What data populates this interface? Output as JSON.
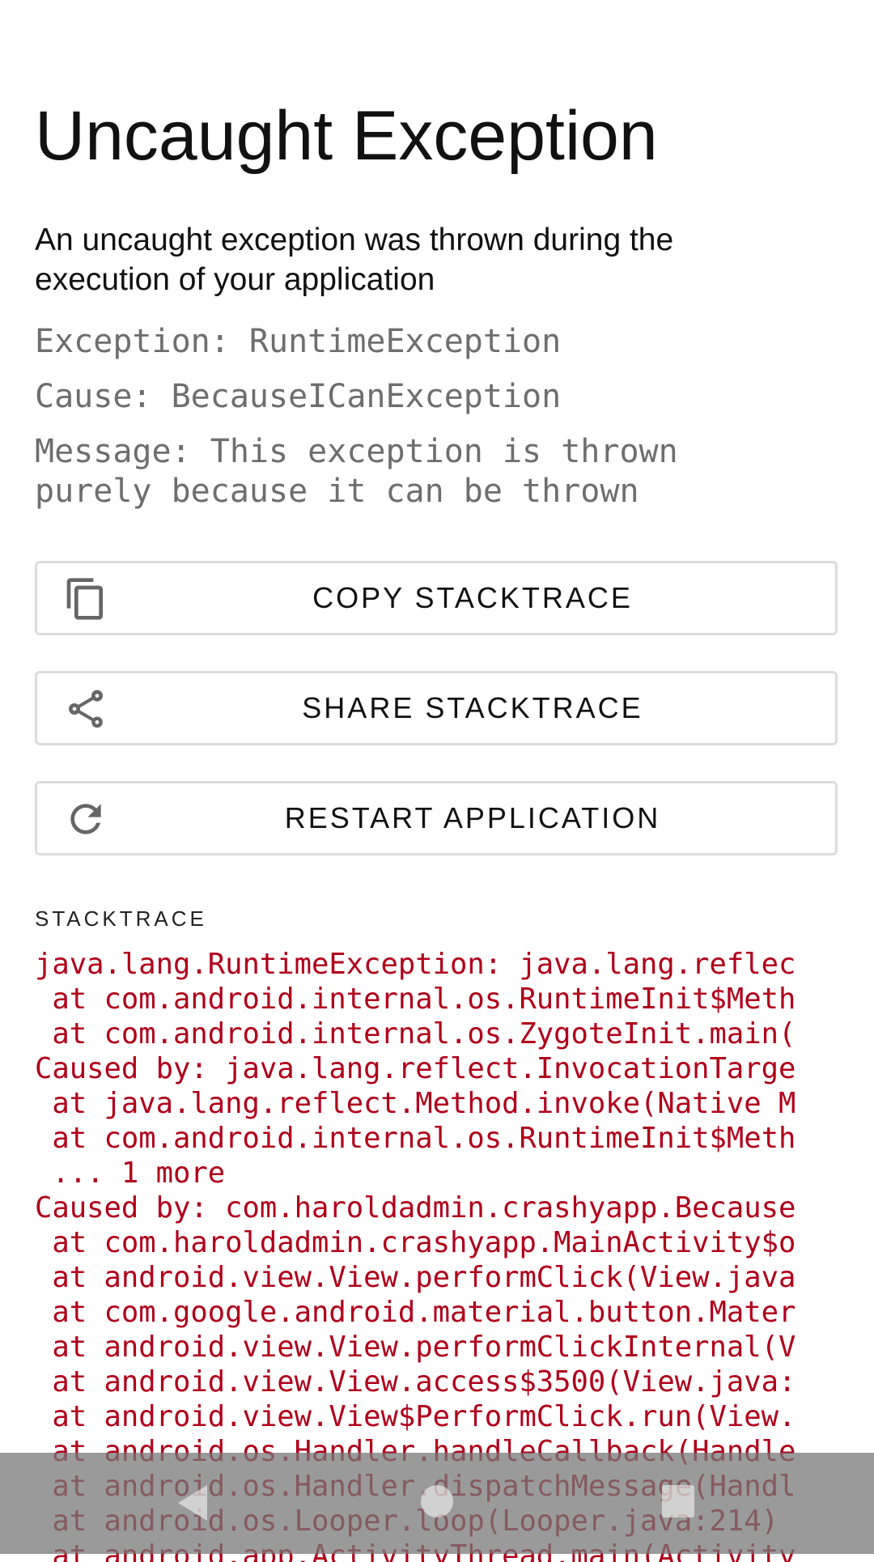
{
  "header": {
    "title": "Uncaught Exception",
    "subtitle": "An uncaught exception was thrown during the execution of your application"
  },
  "details": {
    "exception": "Exception: RuntimeException",
    "cause": "Cause: BecauseICanException",
    "message_line1": "Message: This exception is thrown",
    "message_line2": "purely because it can be thrown"
  },
  "buttons": {
    "copy": {
      "label": "COPY STACKTRACE",
      "icon": "copy-icon"
    },
    "share": {
      "label": "SHARE STACKTRACE",
      "icon": "share-icon"
    },
    "restart": {
      "label": "RESTART APPLICATION",
      "icon": "refresh-icon"
    }
  },
  "stacktrace": {
    "label": "STACKTRACE",
    "lines": [
      "java.lang.RuntimeException: java.lang.reflec",
      " at com.android.internal.os.RuntimeInit$Meth",
      " at com.android.internal.os.ZygoteInit.main(",
      "Caused by: java.lang.reflect.InvocationTarge",
      " at java.lang.reflect.Method.invoke(Native M",
      " at com.android.internal.os.RuntimeInit$Meth",
      " ... 1 more",
      "Caused by: com.haroldadmin.crashyapp.Because",
      " at com.haroldadmin.crashyapp.MainActivity$o",
      " at android.view.View.performClick(View.java",
      " at com.google.android.material.button.Mater",
      " at android.view.View.performClickInternal(V",
      " at android.view.View.access$3500(View.java:",
      " at android.view.View$PerformClick.run(View.",
      " at android.os.Handler.handleCallback(Handle",
      " at android.os.Handler.dispatchMessage(Handl",
      " at android.os.Looper.loop(Looper.java:214)",
      " at android.app.ActivityThread.main(Activity"
    ]
  },
  "colors": {
    "stacktrace_text": "#b0001a",
    "info_text": "#6e6e6e",
    "button_border": "#dcdcdc"
  }
}
